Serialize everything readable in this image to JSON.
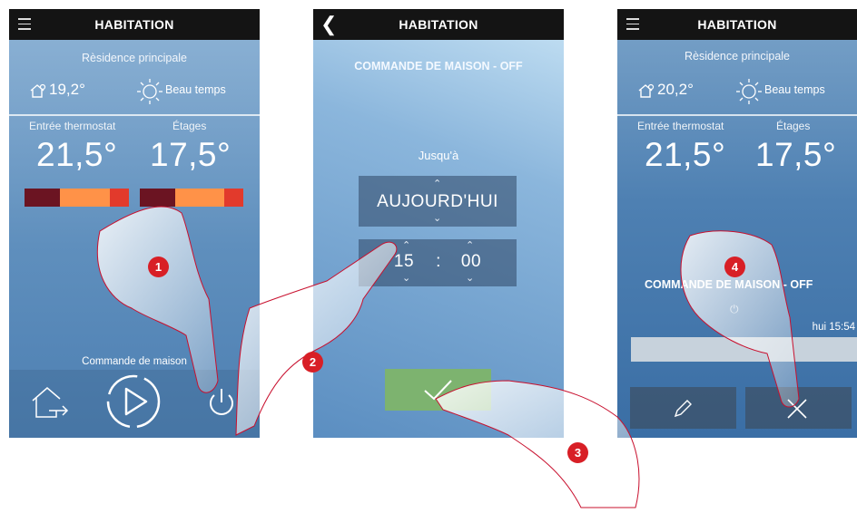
{
  "screens": [
    {
      "title": "HABITATION",
      "residence": "Rèsidence principale",
      "home_temp": "19,2°",
      "weather": "Beau temps",
      "thermostat_label": "Entrée thermostat",
      "floors_label": "Étages",
      "thermostat_temp": "21,5°",
      "floors_temp": "17,5°",
      "bottom_label": "Commande de maison"
    },
    {
      "title": "HABITATION",
      "header": "COMMANDE DE MAISON - OFF",
      "until_label": "Jusqu'à",
      "day_value": "AUJOURD'HUI",
      "hour_value": "15",
      "minute_value": "00",
      "separator": ":"
    },
    {
      "title": "HABITATION",
      "residence": "Rèsidence principale",
      "home_temp": "20,2°",
      "weather": "Beau temps",
      "thermostat_label": "Entrée thermostat",
      "floors_label": "Étages",
      "thermostat_temp": "21,5°",
      "floors_temp": "17,5°",
      "status_header": "COMMANDE DE MAISON - OFF",
      "status_time": "hui 15:54"
    }
  ],
  "badges": [
    "1",
    "2",
    "3",
    "4"
  ],
  "colors": {
    "topbar": "#141414",
    "bar_dark": "#6b1422",
    "bar_orange": "#ff9248",
    "bar_red": "#e23a2c",
    "confirm_green": "#7db36f",
    "badge_red": "#d81f26"
  }
}
